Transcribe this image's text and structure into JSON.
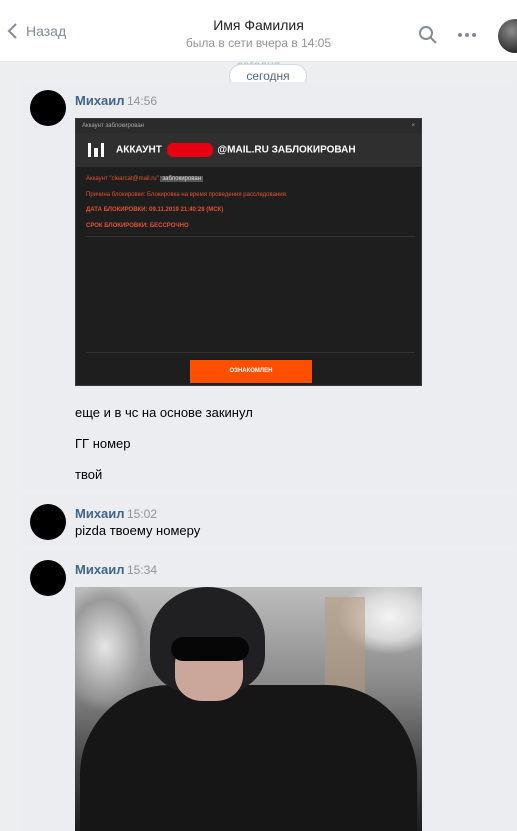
{
  "header": {
    "back_label": "Назад",
    "name": "Имя Фамилия",
    "status": "была в сети вчера в 14:05"
  },
  "date_ghost": "сегодня",
  "date_pill": "сегодня",
  "messages": [
    {
      "author": "Михаил",
      "time": "14:56",
      "lines": [
        "еще и в чс на основе закинул",
        "ГГ номер",
        "твой"
      ],
      "screenshot": {
        "window_title": "Аккаунт заблокирован",
        "close": "×",
        "heading_left": "АККАУНТ",
        "heading_right": "@MAIL.RU ЗАБЛОКИРОВАН",
        "line1_prefix": "Аккаунт \"clearcat@mail.ru\"",
        "line1_tag": "заблокирован",
        "line2": "Причина блокировки: Блокировка на время проведения расследования.",
        "line3": "ДАТА БЛОКИРОВКИ: 09.11.2019 21:40:28 (МСК)",
        "line4": "СРОК БЛОКИРОВКИ: БЕССРОЧНО",
        "button": "ОЗНАКОМЛЕН"
      }
    },
    {
      "author": "Михаил",
      "time": "15:02",
      "lines": [
        "pizda твоему номеру"
      ]
    },
    {
      "author": "Михаил",
      "time": "15:34",
      "lines": []
    }
  ]
}
